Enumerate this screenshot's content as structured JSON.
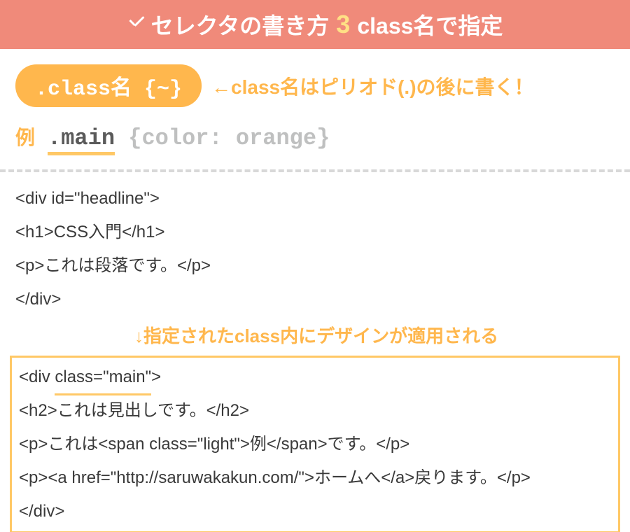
{
  "header": {
    "title_left": "セレクタの書き方",
    "number": "3",
    "title_right": "class名で指定"
  },
  "pill": {
    "text": ".class名 {~}",
    "note": "←class名はピリオド(.)の後に書く！"
  },
  "example": {
    "label": "例",
    "selector": ".main",
    "rest": " {color: orange}"
  },
  "code": {
    "line1": "<div id=\"headline\">",
    "line2": "<h1>CSS入門</h1>",
    "line3": "<p>これは段落です。</p>",
    "line4": "</div>",
    "annotation": "↓指定されたclass内にデザインが適用される",
    "box_line1_pre": "<div ",
    "box_line1_underlined": "class=\"main\"",
    "box_line1_post": ">",
    "box_line2": "<h2>これは見出しです。</h2>",
    "box_line3": "<p>これは<span class=\"light\">例</span>です。</p>",
    "box_line4": "<p><a href=\"http://saruwakakun.com/\">ホームへ</a>戻ります。</p>",
    "box_line5": "</div>"
  }
}
